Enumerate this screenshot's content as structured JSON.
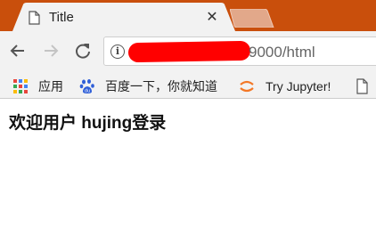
{
  "tab": {
    "title": "Title",
    "close_icon": "close-icon",
    "page_icon": "document-icon"
  },
  "toolbar": {
    "back_icon": "back-arrow-icon",
    "forward_icon": "forward-arrow-icon",
    "reload_icon": "reload-icon",
    "info_icon": "info-icon",
    "url_visible": "9000/html"
  },
  "bookmarks": [
    {
      "label": "应用",
      "icon": "apps-grid-icon"
    },
    {
      "label": "百度一下，你就知道",
      "icon": "baidu-paw-icon"
    },
    {
      "label": "Try Jupyter!",
      "icon": "jupyter-icon"
    },
    {
      "label": "",
      "icon": "document-icon"
    }
  ],
  "page": {
    "heading": "欢迎用户 hujing登录"
  },
  "colors": {
    "tabstrip": "#c94f0c",
    "toolbar": "#f2f2f2",
    "redaction": "#ff0000"
  }
}
